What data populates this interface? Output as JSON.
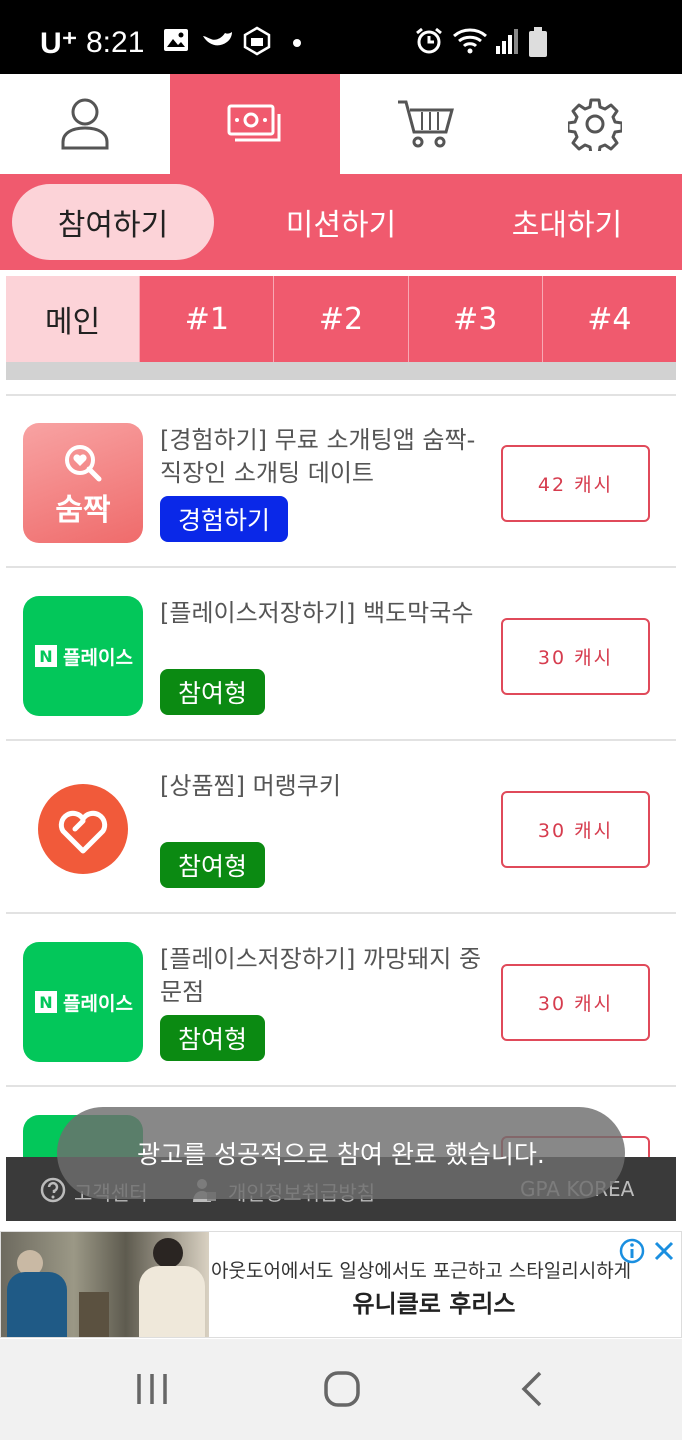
{
  "status_bar": {
    "carrier": "U⁺",
    "time": "8:21"
  },
  "top_nav": {
    "tabs": [
      {
        "name": "profile",
        "icon": "person-icon"
      },
      {
        "name": "money",
        "icon": "cash-icon",
        "active": true
      },
      {
        "name": "shop",
        "icon": "cart-icon"
      },
      {
        "name": "settings",
        "icon": "gear-icon"
      }
    ]
  },
  "sub_tabs": {
    "items": [
      "참여하기",
      "미션하기",
      "초대하기"
    ],
    "active_index": 0
  },
  "num_tabs": {
    "items": [
      "메인",
      "#1",
      "#2",
      "#3",
      "#4"
    ],
    "active_index": 0
  },
  "offers": [
    {
      "title": "[경험하기] 무료 소개팅앱 숨짝- 직장인 소개팅 데이트",
      "badge": "경험하기",
      "badge_color": "#0a28e8",
      "reward": "42 캐시",
      "thumb_label": "숨짝"
    },
    {
      "title": "[플레이스저장하기] 백도막국수",
      "badge": "참여형",
      "badge_color": "#0b8a12",
      "reward": "30 캐시",
      "thumb_label": "플레이스"
    },
    {
      "title": "[상품찜] 머랭쿠키",
      "badge": "참여형",
      "badge_color": "#0b8a12",
      "reward": "30 캐시",
      "thumb_label": ""
    },
    {
      "title": "[플레이스저장하기] 까망돼지 중문점",
      "badge": "참여형",
      "badge_color": "#0b8a12",
      "reward": "30 캐시",
      "thumb_label": "플레이스"
    }
  ],
  "footer": {
    "help": "고객센터",
    "privacy": "개인정보취급방침",
    "brand": "GPA KOREA"
  },
  "toast": "광고를 성공적으로 참여 완료 했습니다.",
  "ad": {
    "text": "아웃도어에서도 일상에서도 포근하고 스타일리시하게",
    "title": "유니클로 후리스"
  },
  "colors": {
    "accent": "#f05a6e",
    "accent_light": "#fcd3d8",
    "naver_green": "#03c75a"
  }
}
